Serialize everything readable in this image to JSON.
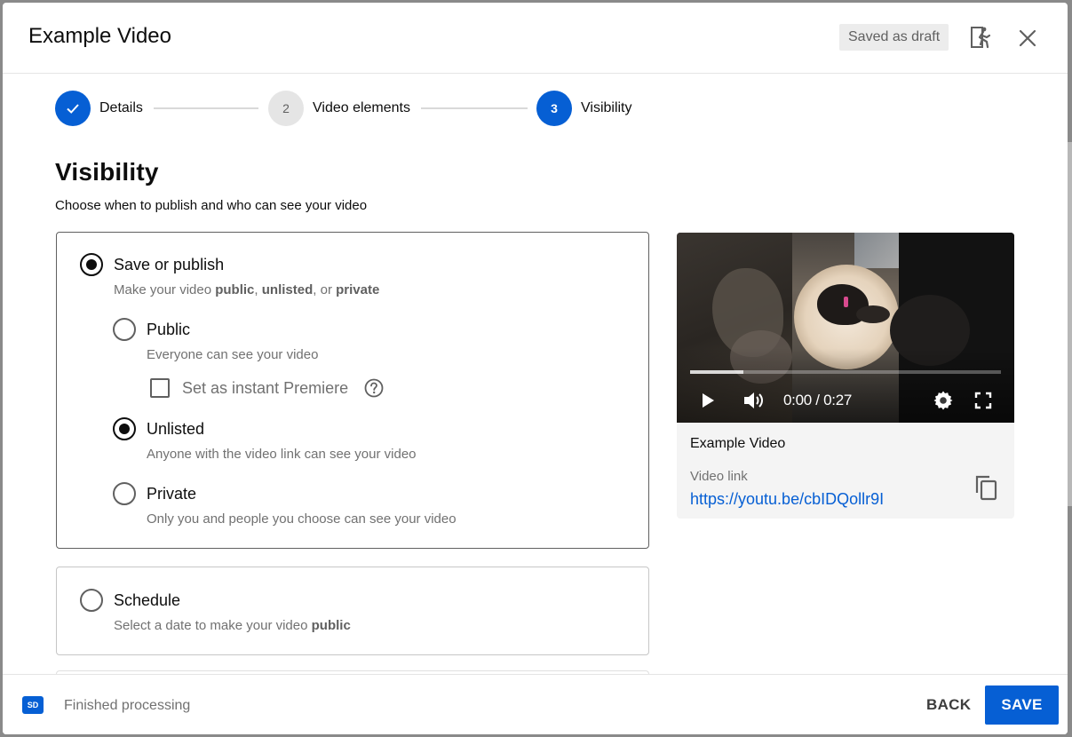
{
  "dialog": {
    "title": "Example Video",
    "draft_status": "Saved as draft"
  },
  "icons": {
    "feedback": "feedback-icon",
    "close": "close-icon",
    "check": "check-icon",
    "help": "help-icon",
    "copy": "copy-icon",
    "play": "play-icon",
    "volume": "volume-icon",
    "settings": "settings-icon",
    "fullscreen": "fullscreen-icon"
  },
  "stepper": {
    "steps": [
      {
        "label": "Details",
        "number": "",
        "state": "done"
      },
      {
        "label": "Video elements",
        "number": "2",
        "state": "pending"
      },
      {
        "label": "Visibility",
        "number": "3",
        "state": "active"
      }
    ]
  },
  "visibility": {
    "title": "Visibility",
    "subtitle": "Choose when to publish and who can see your video",
    "save_or_publish": {
      "label": "Save or publish",
      "checked": true,
      "desc_prefix": "Make your video ",
      "desc_public": "public",
      "desc_sep1": ", ",
      "desc_unlisted": "unlisted",
      "desc_sep2": ", or ",
      "desc_private": "private"
    },
    "options": [
      {
        "label": "Public",
        "desc": "Everyone can see your video",
        "checked": false
      },
      {
        "label": "Unlisted",
        "desc": "Anyone with the video link can see your video",
        "checked": true
      },
      {
        "label": "Private",
        "desc": "Only you and people you choose can see your video",
        "checked": false
      }
    ],
    "premiere": {
      "label": "Set as instant Premiere",
      "checked": false
    },
    "schedule": {
      "label": "Schedule",
      "checked": false,
      "desc_prefix": "Select a date to make your video ",
      "desc_bold": "public"
    }
  },
  "preview": {
    "time": "0:00 / 0:27",
    "progress_fraction": 0.17,
    "title": "Example Video",
    "link_label": "Video link",
    "link": "https://youtu.be/cbIDQollr9I"
  },
  "footer": {
    "quality_badge": "SD",
    "processing_status": "Finished processing",
    "back_label": "BACK",
    "save_label": "SAVE"
  },
  "colors": {
    "accent": "#065fd4",
    "text_primary": "#0d0d0d",
    "text_secondary": "#717171"
  }
}
